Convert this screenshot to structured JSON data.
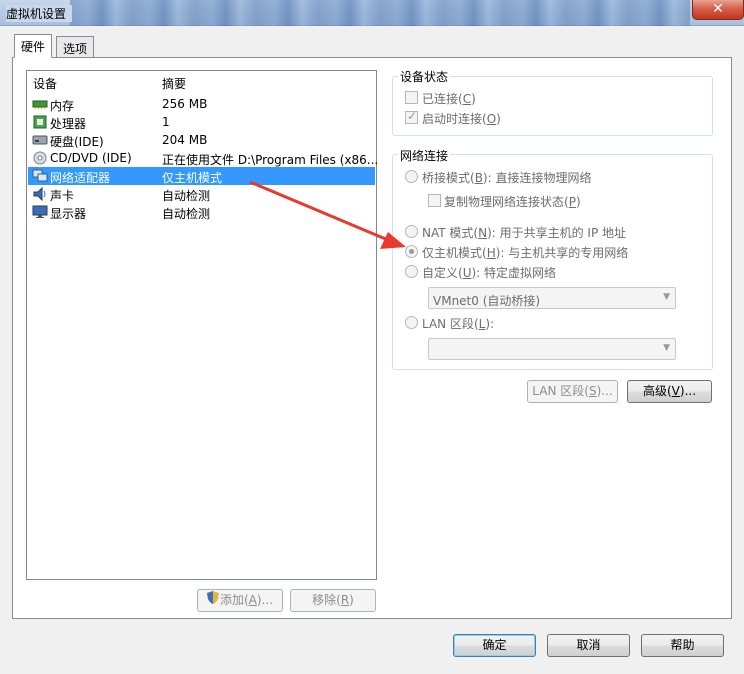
{
  "window": {
    "title": "虚拟机设置",
    "close_glyph": "✕"
  },
  "tabs": [
    {
      "label": "硬件"
    },
    {
      "label": "选项"
    }
  ],
  "device_list": {
    "col_device": "设备",
    "col_summary": "摘要",
    "rows": [
      {
        "name": "内存",
        "summary": "256 MB",
        "icon": "memory-icon"
      },
      {
        "name": "处理器",
        "summary": "1",
        "icon": "processor-icon"
      },
      {
        "name": "硬盘(IDE)",
        "summary": "204 MB",
        "icon": "hard-disk-icon"
      },
      {
        "name": "CD/DVD (IDE)",
        "summary": "正在使用文件 D:\\Program Files (x86...",
        "icon": "cd-dvd-icon"
      },
      {
        "name": "网络适配器",
        "summary": "仅主机模式",
        "icon": "network-adapter-icon",
        "selected": true
      },
      {
        "name": "声卡",
        "summary": "自动检测",
        "icon": "sound-card-icon"
      },
      {
        "name": "显示器",
        "summary": "自动检测",
        "icon": "display-icon"
      }
    ]
  },
  "list_buttons": {
    "add_pre": "添加(",
    "add_key": "A",
    "add_post": ")...",
    "remove_pre": "移除(",
    "remove_key": "R",
    "remove_post": ")"
  },
  "device_status": {
    "title": "设备状态",
    "connected_pre": "已连接(",
    "connected_key": "C",
    "connected_post": ")",
    "connect_on_power_pre": "启动时连接(",
    "connect_on_power_key": "O",
    "connect_on_power_post": ")",
    "connected_checked": false,
    "connect_on_power_checked": true
  },
  "network": {
    "title": "网络连接",
    "bridged_pre": "桥接模式(",
    "bridged_key": "B",
    "bridged_post": "): 直接连接物理网络",
    "replicate_pre": "复制物理网络连接状态(",
    "replicate_key": "P",
    "replicate_post": ")",
    "nat_pre": "NAT 模式(",
    "nat_key": "N",
    "nat_post": "): 用于共享主机的 IP 地址",
    "hostonly_pre": "仅主机模式(",
    "hostonly_key": "H",
    "hostonly_post": "): 与主机共享的专用网络",
    "custom_pre": "自定义(",
    "custom_key": "U",
    "custom_post": "): 特定虚拟网络",
    "custom_select": "VMnet0 (自动桥接)",
    "lan_pre": "LAN 区段(",
    "lan_key": "L",
    "lan_post": "):",
    "lan_select": "",
    "selected": "hostonly"
  },
  "network_buttons": {
    "lan_pre": "LAN 区段(",
    "lan_key": "S",
    "lan_post": ")...",
    "advanced_pre": "高级(",
    "advanced_key": "V",
    "advanced_post": ")..."
  },
  "dialog_buttons": {
    "ok": "确定",
    "cancel": "取消",
    "help": "帮助"
  },
  "colors": {
    "selection": "#3399ff",
    "annotation_arrow": "#e8392e"
  }
}
